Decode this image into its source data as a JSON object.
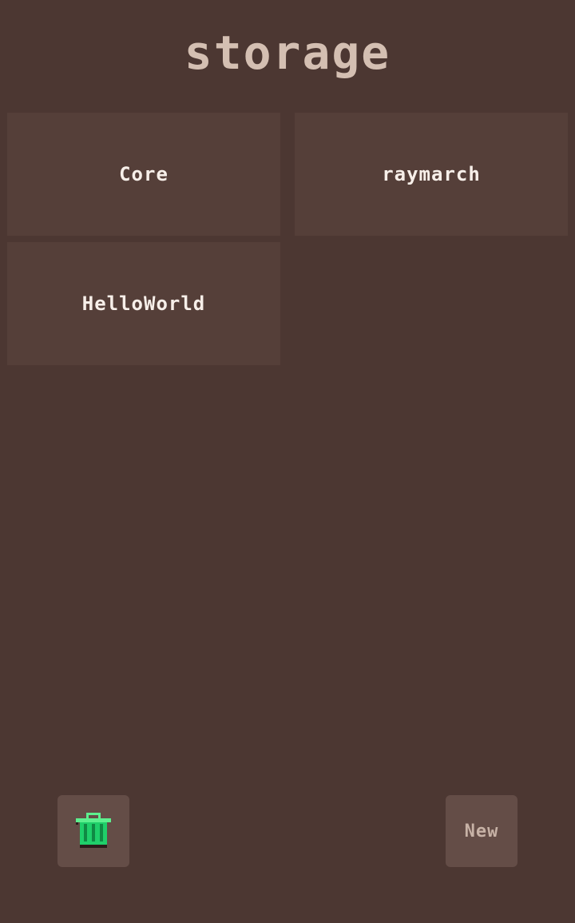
{
  "header": {
    "title": "storage"
  },
  "storage": {
    "items": [
      {
        "label": "Core"
      },
      {
        "label": "raymarch"
      },
      {
        "label": "HelloWorld"
      }
    ]
  },
  "toolbar": {
    "delete_icon": "trash-icon",
    "new_label": "New"
  },
  "colors": {
    "background": "#4c3732",
    "tile": "#553f39",
    "title": "#d4bfb2",
    "button": "#644d47",
    "icon_accent": "#2ee87a"
  }
}
